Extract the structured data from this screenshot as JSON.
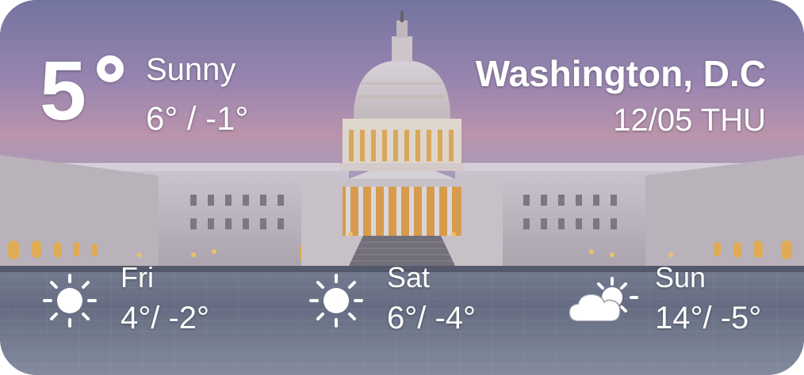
{
  "current": {
    "temperature": "5",
    "condition": "Sunny",
    "high_low": "6° / -1°"
  },
  "location": {
    "city": "Washington, D.C",
    "date": "12/05 THU"
  },
  "forecast": [
    {
      "day": "Fri",
      "temps": "4°/ -2°",
      "icon": "sun-icon"
    },
    {
      "day": "Sat",
      "temps": "6°/ -4°",
      "icon": "sun-icon"
    },
    {
      "day": "Sun",
      "temps": "14°/ -5°",
      "icon": "partly-cloudy-icon"
    }
  ],
  "colors": {
    "text": "#ffffff",
    "sky_top": "#7f7fa8",
    "sky_glow": "#c69bb4",
    "plaza": "#6f7789"
  }
}
